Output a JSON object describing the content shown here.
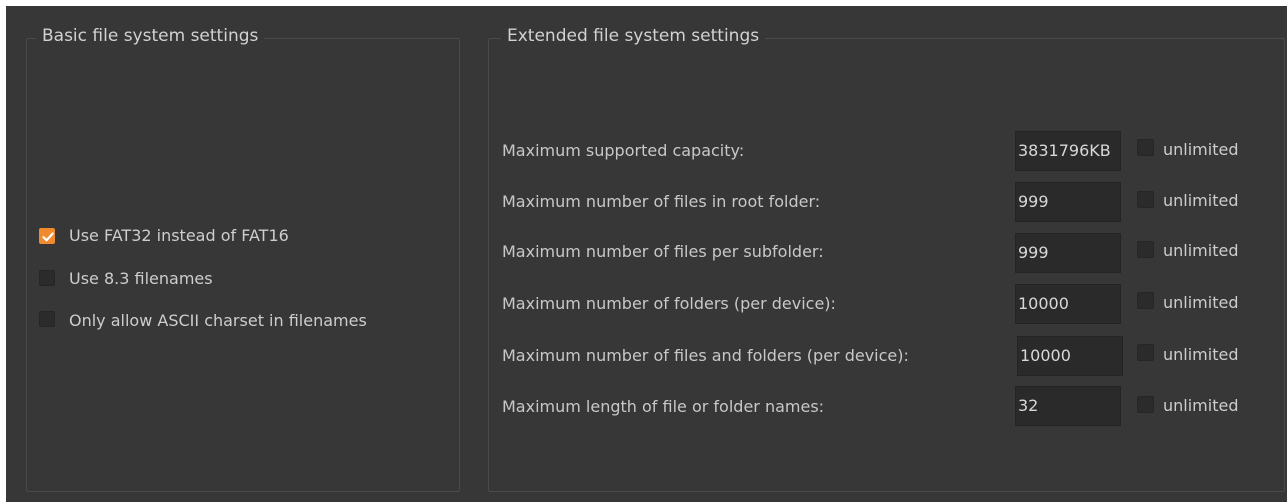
{
  "basic": {
    "title": "Basic file system settings",
    "options": [
      {
        "label": "Use FAT32 instead of FAT16",
        "checked": true
      },
      {
        "label": "Use 8.3 filenames",
        "checked": false
      },
      {
        "label": "Only allow ASCII charset in filenames",
        "checked": false
      }
    ]
  },
  "extended": {
    "title": "Extended file system settings",
    "rows": [
      {
        "label": "Maximum supported capacity:",
        "value": "3831796KB",
        "unlimited_label": "unlimited",
        "unlimited": false
      },
      {
        "label": "Maximum number of files in root folder:",
        "value": "999",
        "unlimited_label": "unlimited",
        "unlimited": false
      },
      {
        "label": "Maximum number of files per subfolder:",
        "value": "999",
        "unlimited_label": "unlimited",
        "unlimited": false
      },
      {
        "label": "Maximum number of folders (per device):",
        "value": "10000",
        "unlimited_label": "unlimited",
        "unlimited": false
      },
      {
        "label": "Maximum number of files and folders (per device):",
        "value": "10000",
        "unlimited_label": "unlimited",
        "unlimited": false
      },
      {
        "label": "Maximum length of file or folder names:",
        "value": "32",
        "unlimited_label": "unlimited",
        "unlimited": false
      }
    ]
  },
  "colors": {
    "background": "#373737",
    "accent": "#f08a2e",
    "field": "#2a2a2a",
    "text": "#cdcdcd"
  }
}
